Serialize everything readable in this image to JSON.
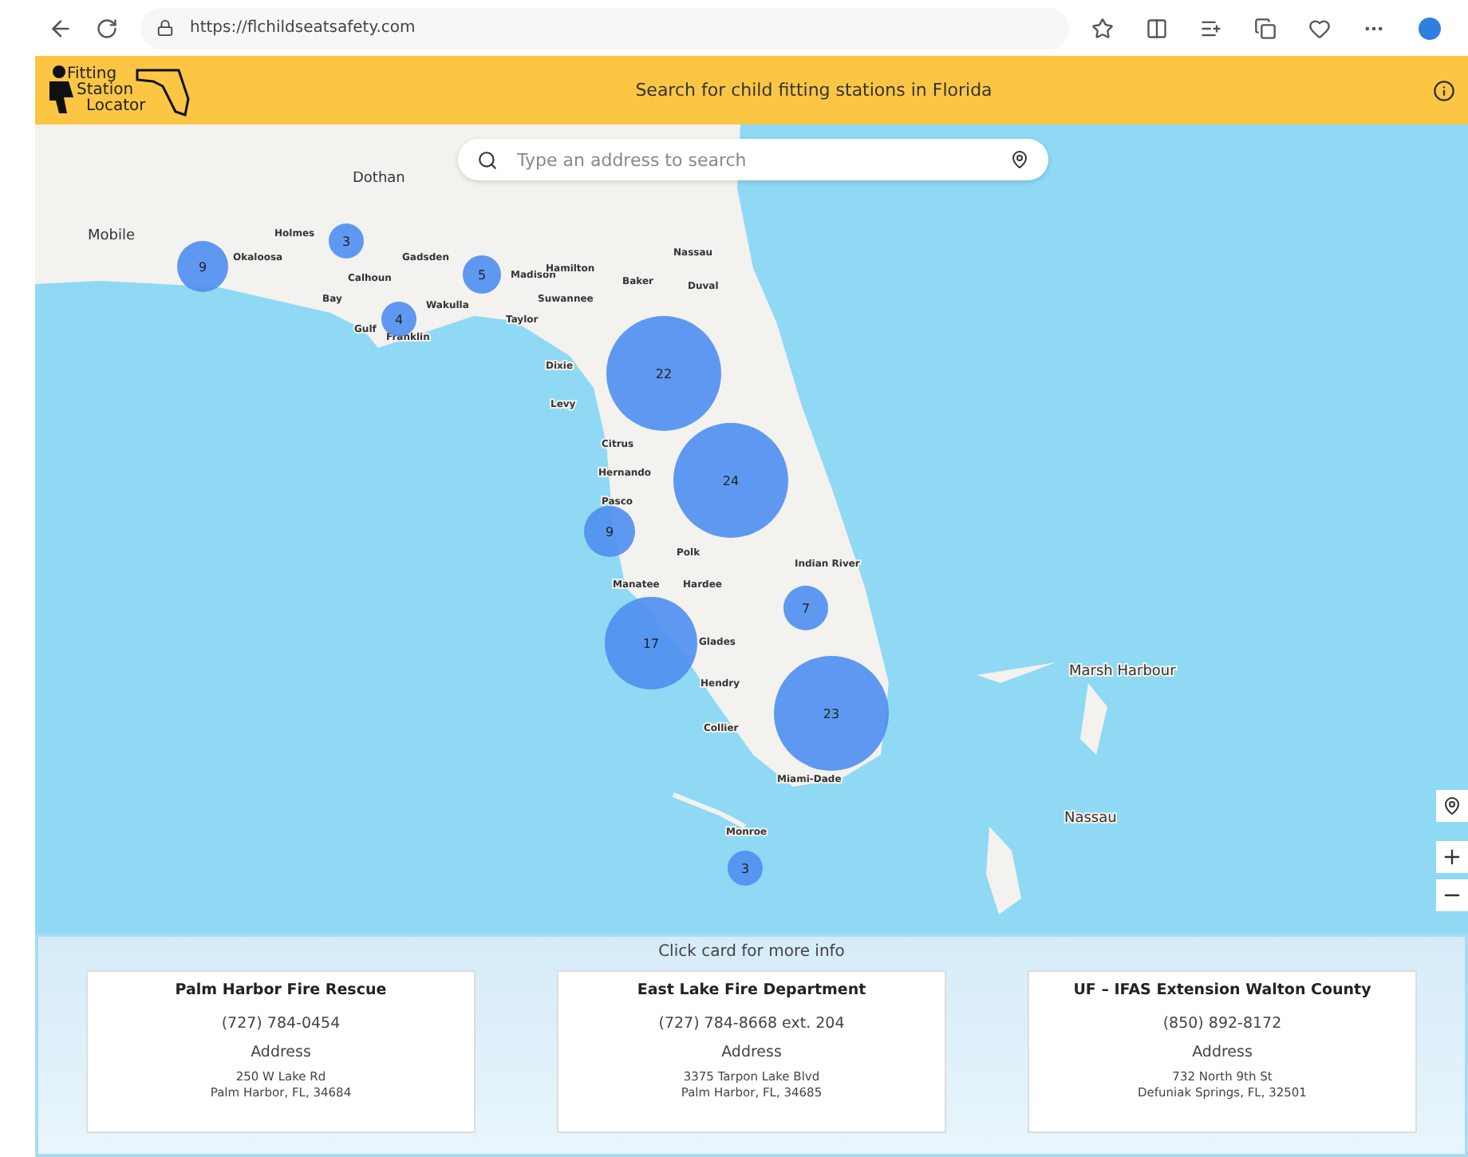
{
  "browser": {
    "url": "https://flchildseatsafety.com"
  },
  "header": {
    "logo_lines": [
      "Fitting",
      "Station",
      "Locator"
    ],
    "title": "Search for child fitting stations in Florida"
  },
  "search": {
    "placeholder": "Type an address to search"
  },
  "map_labels": [
    "Dothan",
    "Mobile",
    "Holmes",
    "Okaloosa",
    "Gadsden",
    "Calhoun",
    "Bay",
    "Gulf",
    "Franklin",
    "Wakulla",
    "Madison",
    "Hamilton",
    "Suwannee",
    "Taylor",
    "Baker",
    "Nassau",
    "Duval",
    "Dixie",
    "Levy",
    "Citrus",
    "Hernando",
    "Pasco",
    "Polk",
    "Indian River",
    "Manatee",
    "Hardee",
    "Glades",
    "Hendry",
    "Collier",
    "Miami-Dade",
    "Monroe",
    "Marsh Harbour",
    "Nassau"
  ],
  "clusters": [
    "9",
    "3",
    "4",
    "5",
    "22",
    "24",
    "9",
    "7",
    "17",
    "23",
    "3"
  ],
  "panel": {
    "hint": "Click card for more info"
  },
  "cards": [
    {
      "name": "Palm Harbor Fire Rescue",
      "phone": "(727) 784-0454",
      "address_label": "Address",
      "address_lines": [
        "250 W Lake Rd",
        "Palm Harbor, FL, 34684"
      ]
    },
    {
      "name": "East Lake Fire Department",
      "phone": "(727) 784-8668 ext. 204",
      "address_label": "Address",
      "address_lines": [
        "3375 Tarpon Lake Blvd",
        "Palm Harbor, FL, 34685"
      ]
    },
    {
      "name": "UF – IFAS Extension Walton County",
      "phone": "(850) 892-8172",
      "address_label": "Address",
      "address_lines": [
        "732 North 9th St",
        "Defuniak Springs, FL, 32501"
      ]
    }
  ]
}
